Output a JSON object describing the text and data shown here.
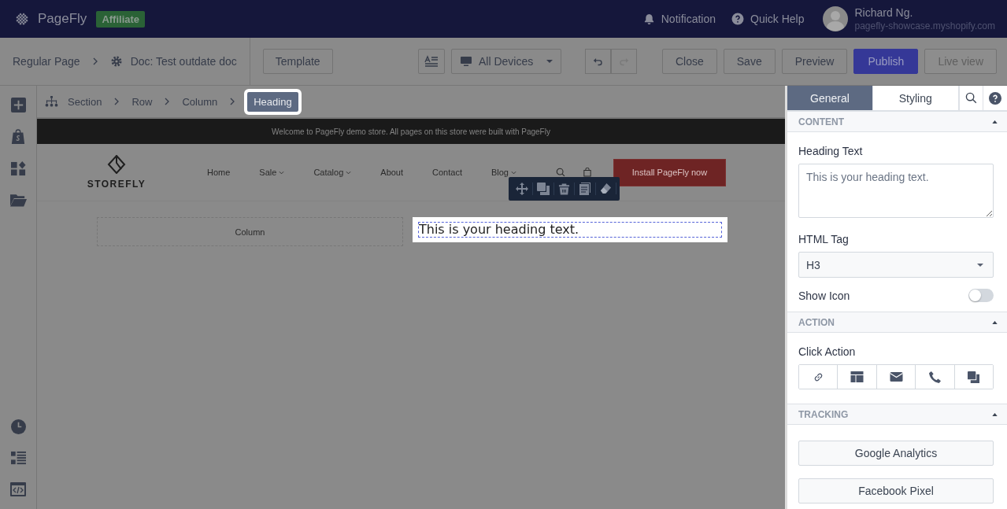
{
  "header": {
    "brand": "PageFly",
    "badge": "Affiliate",
    "notification": "Notification",
    "help": "Quick Help",
    "user": {
      "name": "Richard Ng.",
      "store": "pagefly-showcase.myshopify.com"
    }
  },
  "toolbar": {
    "page_type": "Regular Page",
    "doc_title": "Doc: Test outdate doc",
    "template": "Template",
    "device": "All Devices",
    "actions": [
      {
        "label": "Close",
        "kind": "default",
        "disabled": false
      },
      {
        "label": "Save",
        "kind": "default",
        "disabled": false
      },
      {
        "label": "Preview",
        "kind": "default",
        "disabled": false
      },
      {
        "label": "Publish",
        "kind": "primary",
        "disabled": false
      },
      {
        "label": "Live view",
        "kind": "default",
        "disabled": true
      }
    ]
  },
  "breadcrumb": [
    {
      "label": "Section",
      "selected": false
    },
    {
      "label": "Row",
      "selected": false
    },
    {
      "label": "Column",
      "selected": false
    },
    {
      "label": "Heading",
      "selected": true
    }
  ],
  "store": {
    "announcement": "Welcome to PageFly demo store. All pages on this store were built with PageFly",
    "logo": "STOREFLY",
    "nav": [
      {
        "label": "Home",
        "dropdown": false
      },
      {
        "label": "Sale",
        "dropdown": true
      },
      {
        "label": "Catalog",
        "dropdown": true
      },
      {
        "label": "About",
        "dropdown": false
      },
      {
        "label": "Contact",
        "dropdown": false
      },
      {
        "label": "Blog",
        "dropdown": true
      }
    ],
    "install_button": "Install PageFly now",
    "column_label": "Column",
    "heading": "This is your heading text."
  },
  "panel": {
    "tabs": [
      {
        "label": "General",
        "selected": true
      },
      {
        "label": "Styling",
        "selected": false
      }
    ],
    "sections": [
      {
        "title": "CONTENT",
        "expanded": true,
        "fields": [
          {
            "kind": "textarea",
            "label": "Heading Text",
            "placeholder": "This is your heading text."
          },
          {
            "kind": "select",
            "label": "HTML Tag",
            "value": "H3"
          },
          {
            "kind": "toggle",
            "label": "Show Icon",
            "on": false
          }
        ]
      },
      {
        "title": "ACTION",
        "expanded": true,
        "fields": [
          {
            "kind": "iconbar",
            "label": "Click Action"
          }
        ]
      },
      {
        "title": "TRACKING",
        "expanded": true,
        "fields": [
          {
            "kind": "button",
            "label": "Google Analytics"
          },
          {
            "kind": "button",
            "label": "Facebook Pixel"
          }
        ]
      }
    ]
  }
}
